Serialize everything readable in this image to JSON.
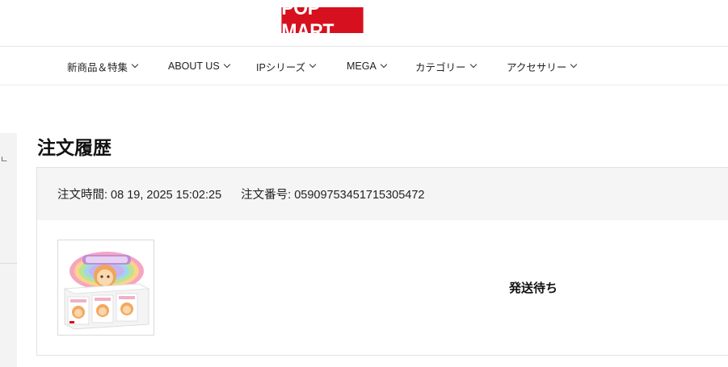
{
  "brand": {
    "logo_text": "POP MART",
    "color": "#d7101f"
  },
  "nav": {
    "items": [
      {
        "label": "新商品＆特集"
      },
      {
        "label": "ABOUT US"
      },
      {
        "label": "IPシリーズ"
      },
      {
        "label": "MEGA"
      },
      {
        "label": "カテゴリー"
      },
      {
        "label": "アクセサリー"
      }
    ]
  },
  "page": {
    "title": "注文履歴"
  },
  "sidebar": {
    "mark": "ㄴ"
  },
  "order": {
    "time_label": "注文時間: 08 19, 2025 15:02:25",
    "number_label": "注文番号: 05909753451715305472",
    "status": "発送待ち",
    "product_icon": "blind-box-display-image"
  }
}
